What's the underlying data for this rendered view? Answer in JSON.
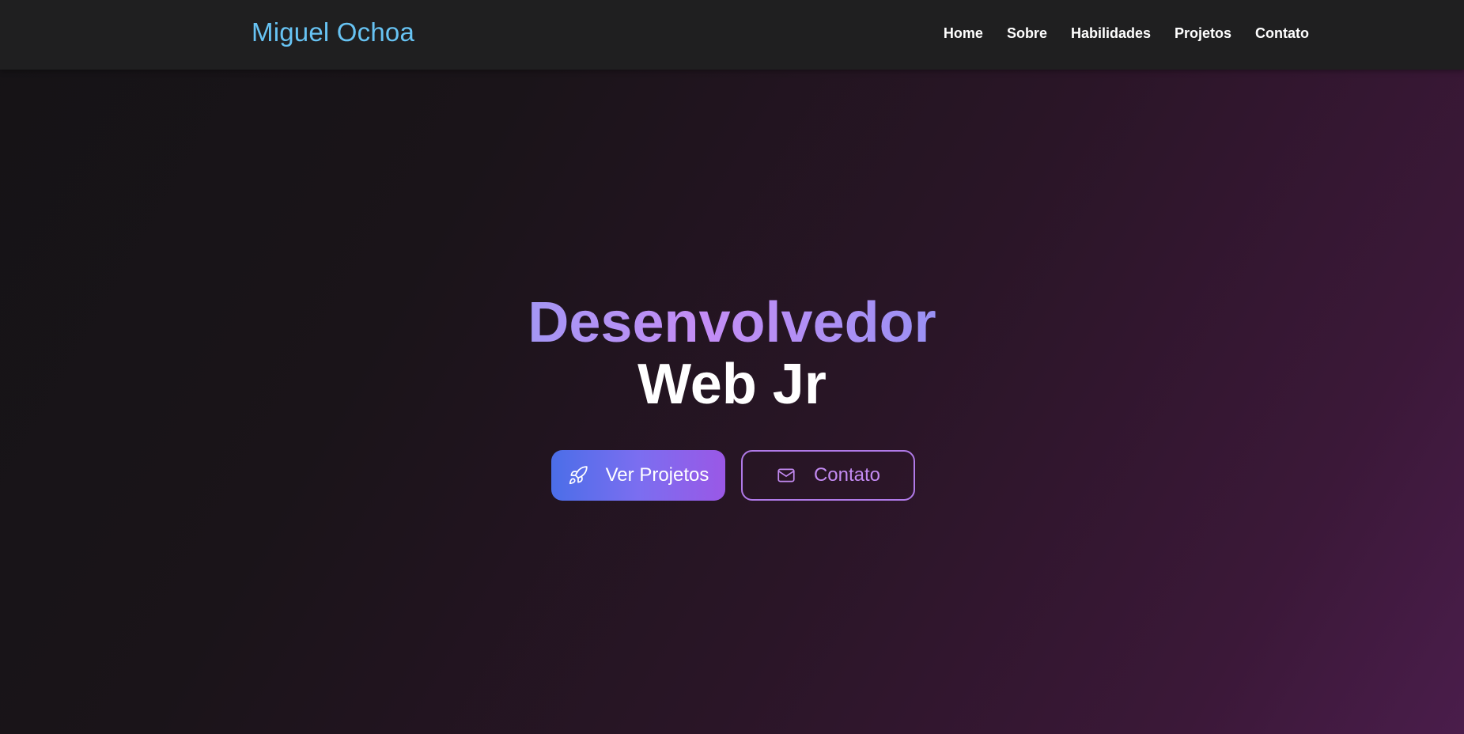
{
  "header": {
    "brand": "Miguel Ochoa",
    "nav": [
      {
        "label": "Home"
      },
      {
        "label": "Sobre"
      },
      {
        "label": "Habilidades"
      },
      {
        "label": "Projetos"
      },
      {
        "label": "Contato"
      }
    ]
  },
  "hero": {
    "title_line1": "Desenvolvedor",
    "title_line2": "Web Jr",
    "primary_button": {
      "label": "Ver Projetos",
      "icon": "rocket-icon"
    },
    "secondary_button": {
      "label": "Contato",
      "icon": "mail-icon"
    }
  },
  "colors": {
    "brand": "#67c3f3",
    "accent_purple": "#9a58e6",
    "accent_blue": "#4b6ee8",
    "outline": "#b07ae8"
  }
}
